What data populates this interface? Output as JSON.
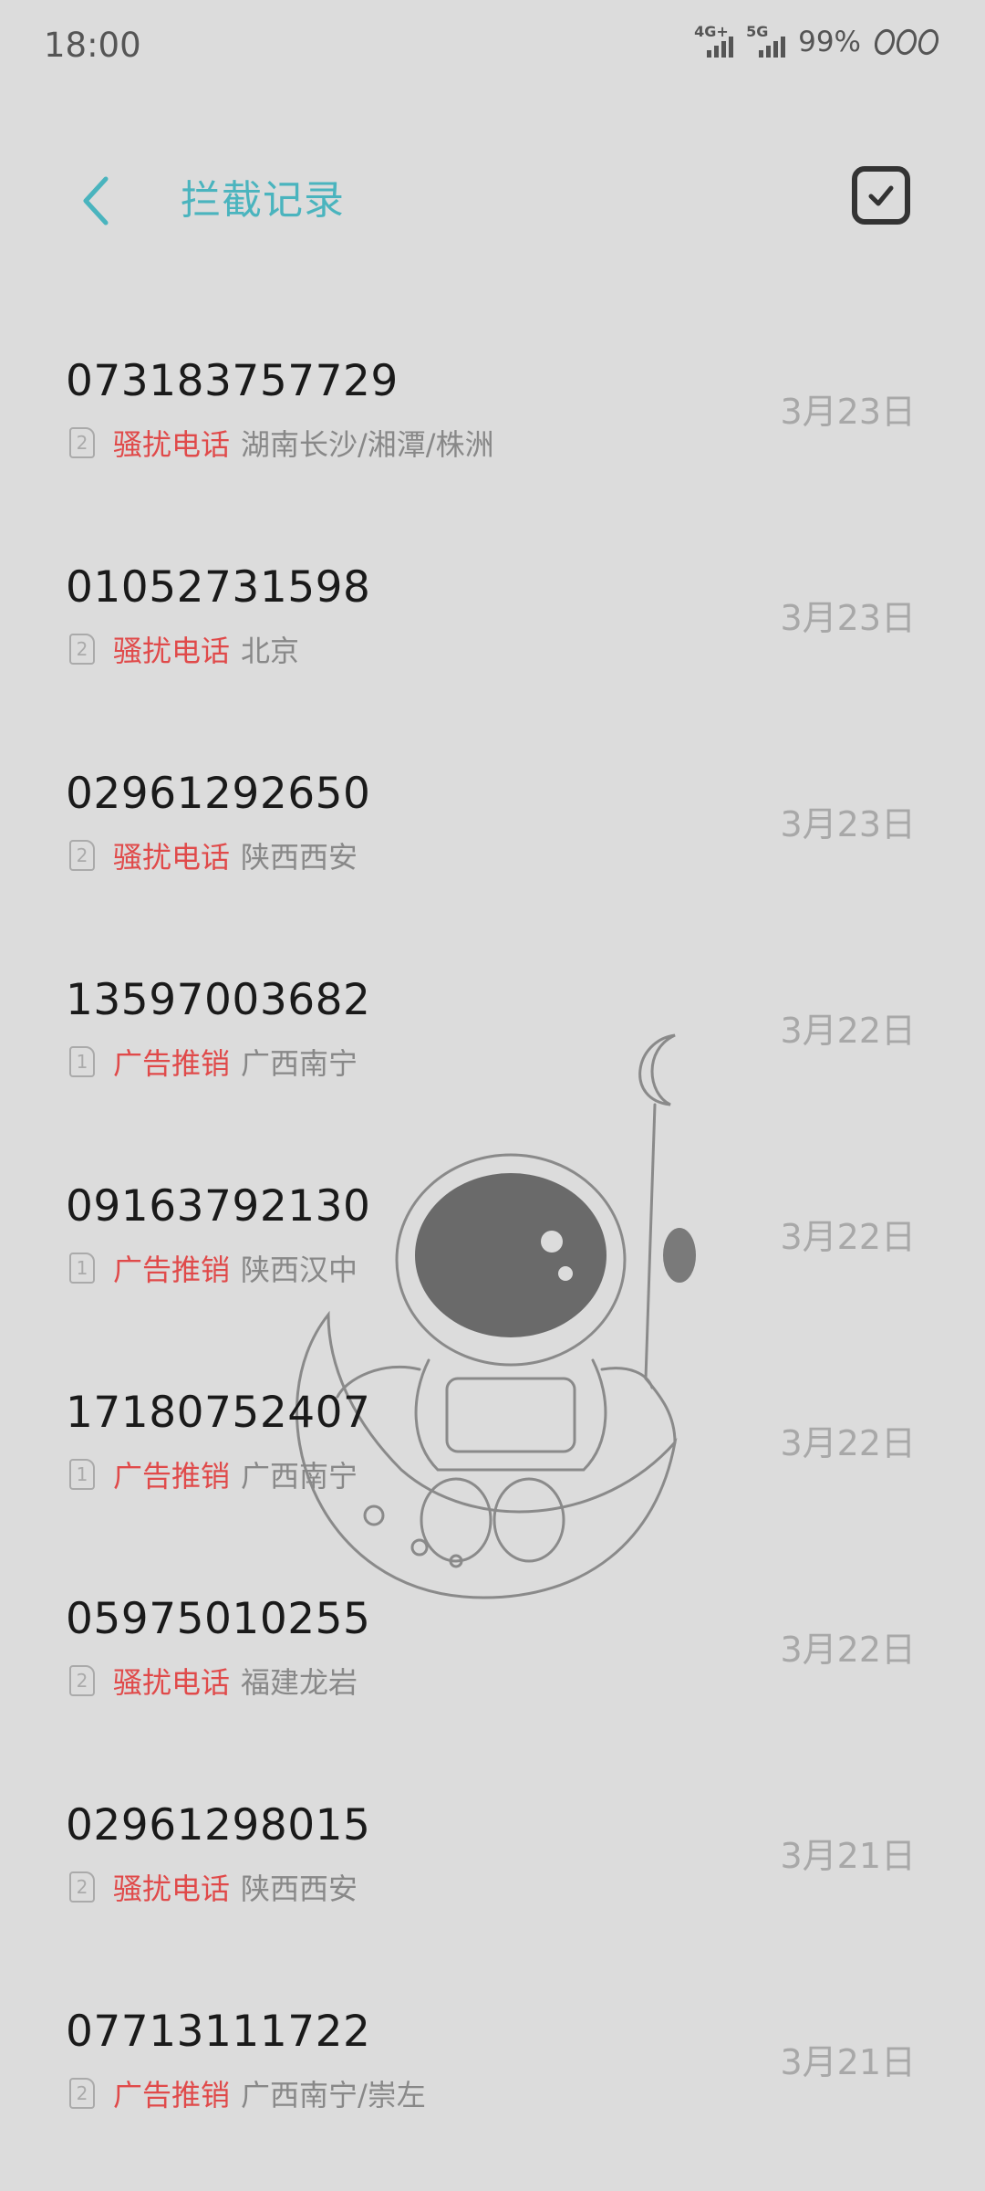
{
  "status_bar": {
    "time": "18:00",
    "sim1_type": "4G+",
    "sim2_type": "5G",
    "battery": "99%"
  },
  "header": {
    "title": "拦截记录",
    "back_icon": "chevron-left-icon",
    "select_icon": "checkbox-icon"
  },
  "colors": {
    "accent": "#4ab4be",
    "category": "#e04a4a",
    "background": "#dcdcdc"
  },
  "records": [
    {
      "number": "073183757729",
      "sim": "2",
      "category": "骚扰电话",
      "location": "湖南长沙/湘潭/株洲",
      "date": "3月23日"
    },
    {
      "number": "01052731598",
      "sim": "2",
      "category": "骚扰电话",
      "location": "北京",
      "date": "3月23日"
    },
    {
      "number": "02961292650",
      "sim": "2",
      "category": "骚扰电话",
      "location": "陕西西安",
      "date": "3月23日"
    },
    {
      "number": "13597003682",
      "sim": "1",
      "category": "广告推销",
      "location": "广西南宁",
      "date": "3月22日"
    },
    {
      "number": "09163792130",
      "sim": "1",
      "category": "广告推销",
      "location": "陕西汉中",
      "date": "3月22日"
    },
    {
      "number": "17180752407",
      "sim": "1",
      "category": "广告推销",
      "location": "广西南宁",
      "date": "3月22日"
    },
    {
      "number": "05975010255",
      "sim": "2",
      "category": "骚扰电话",
      "location": "福建龙岩",
      "date": "3月22日"
    },
    {
      "number": "02961298015",
      "sim": "2",
      "category": "骚扰电话",
      "location": "陕西西安",
      "date": "3月21日"
    },
    {
      "number": "07713111722",
      "sim": "2",
      "category": "广告推销",
      "location": "广西南宁/崇左",
      "date": "3月21日"
    }
  ]
}
